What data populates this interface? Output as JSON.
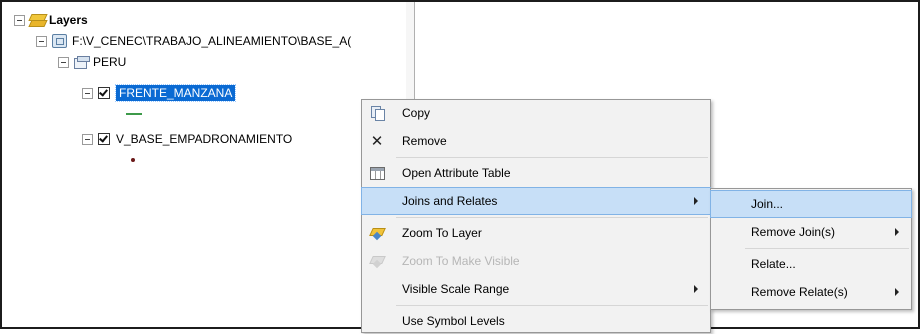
{
  "toc": {
    "root_label": "Layers",
    "workspace_label": "F:\\V_CENEC\\TRABAJO_ALINEAMIENTO\\BASE_A(",
    "group_label": "PERU",
    "layers": [
      {
        "label": "FRENTE_MANZANA",
        "checked": true,
        "selected": true,
        "symbol": "green-line"
      },
      {
        "label": "V_BASE_EMPADRONAMIENTO",
        "checked": true,
        "selected": false,
        "symbol": "dark-red-point"
      }
    ]
  },
  "context_menu": {
    "items": [
      {
        "label": "Copy",
        "icon": "copy-icon",
        "enabled": true
      },
      {
        "label": "Remove",
        "icon": "remove-x-icon",
        "enabled": true
      },
      {
        "label": "Open Attribute Table",
        "icon": "attribute-table-icon",
        "enabled": true
      },
      {
        "label": "Joins and Relates",
        "icon": "",
        "enabled": true,
        "has_submenu": true,
        "highlighted": true
      },
      {
        "label": "Zoom To Layer",
        "icon": "zoom-to-layer-icon",
        "enabled": true
      },
      {
        "label": "Zoom To Make Visible",
        "icon": "zoom-to-make-visible-icon",
        "enabled": false
      },
      {
        "label": "Visible Scale Range",
        "icon": "",
        "enabled": true,
        "has_submenu": true
      },
      {
        "label": "Use Symbol Levels",
        "icon": "",
        "enabled": true
      }
    ]
  },
  "submenu": {
    "items": [
      {
        "label": "Join...",
        "highlighted": true
      },
      {
        "label": "Remove Join(s)",
        "has_submenu": true
      },
      {
        "label": "Relate..."
      },
      {
        "label": "Remove Relate(s)",
        "has_submenu": true
      }
    ]
  },
  "colors": {
    "selection": "#0a6ad3",
    "menu_highlight": "#c7dff7",
    "line_symbol": "#3d9a4a",
    "point_symbol": "#6b1a1a"
  }
}
